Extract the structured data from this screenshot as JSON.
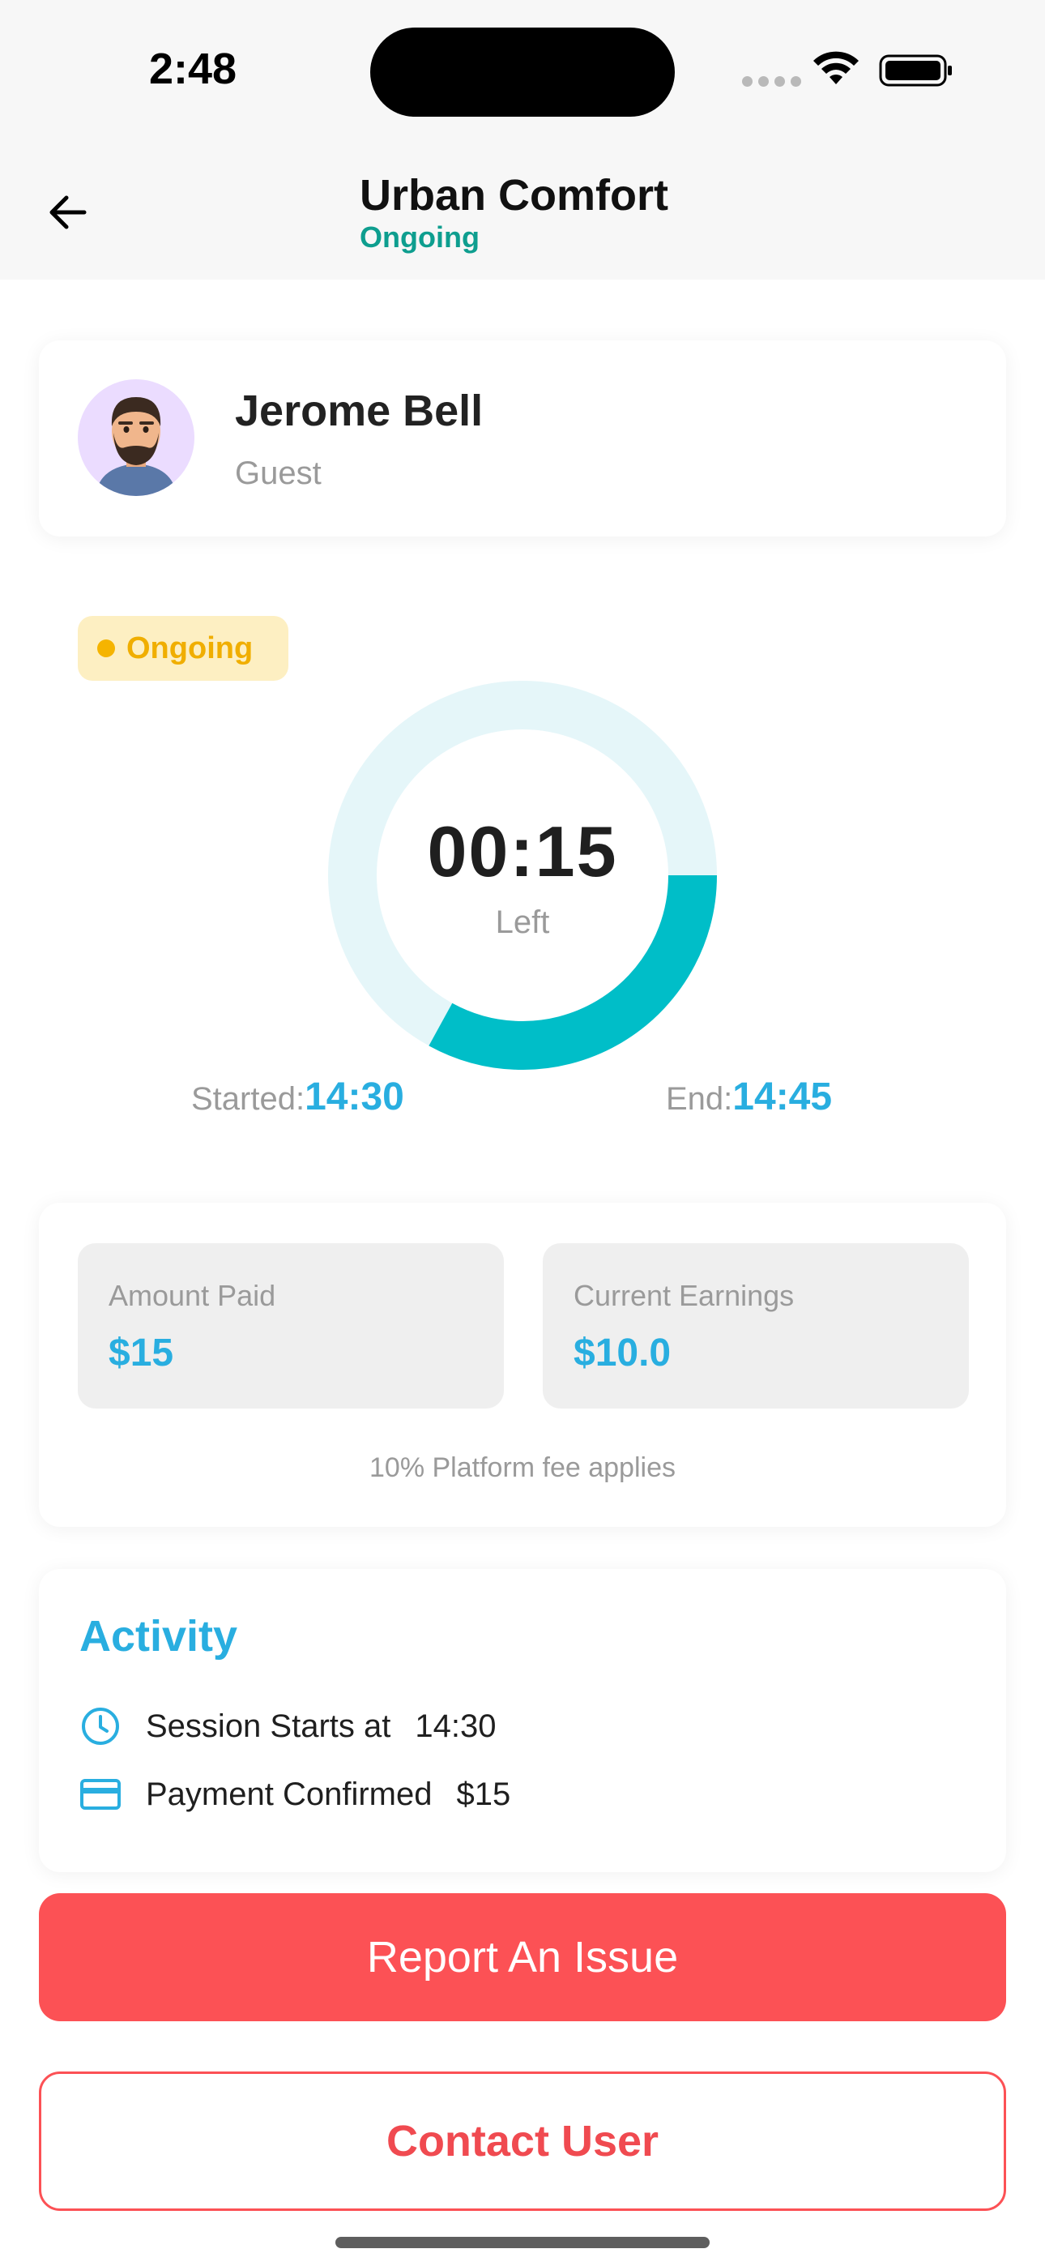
{
  "status_bar": {
    "time": "2:48"
  },
  "header": {
    "title": "Urban Comfort",
    "status": "Ongoing"
  },
  "user": {
    "name": "Jerome Bell",
    "role": "Guest"
  },
  "session": {
    "badge": "Ongoing",
    "timer": "00:15",
    "timer_caption": "Left",
    "progress_fraction": 0.33,
    "started_label": "Started:",
    "started_time": "14:30",
    "end_label": "End:",
    "end_time": "14:45"
  },
  "payment": {
    "amount_paid_label": "Amount Paid",
    "amount_paid_value": "$15",
    "earnings_label": "Current Earnings",
    "earnings_value": "$10.0",
    "fee_note": "10% Platform fee applies"
  },
  "activity": {
    "title": "Activity",
    "items": [
      {
        "icon": "clock-icon",
        "text": "Session Starts at",
        "value": "14:30"
      },
      {
        "icon": "credit-card-icon",
        "text": "Payment Confirmed",
        "value": "$15"
      }
    ]
  },
  "actions": {
    "report_label": "Report An Issue",
    "contact_label": "Contact User"
  },
  "colors": {
    "accent_teal": "#00bec8",
    "ring_track": "#e5f6f9",
    "blue_value": "#29aee0",
    "danger": "#fc5155",
    "badge_bg": "#fdefc2",
    "badge_text": "#f0ae00",
    "status_green": "#0e9e8f"
  }
}
